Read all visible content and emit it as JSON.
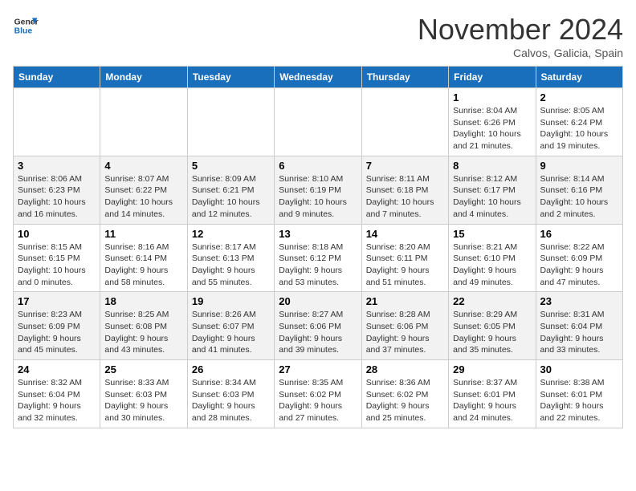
{
  "logo": {
    "line1": "General",
    "line2": "Blue"
  },
  "title": "November 2024",
  "location": "Calvos, Galicia, Spain",
  "weekdays": [
    "Sunday",
    "Monday",
    "Tuesday",
    "Wednesday",
    "Thursday",
    "Friday",
    "Saturday"
  ],
  "weeks": [
    [
      {
        "day": "",
        "info": ""
      },
      {
        "day": "",
        "info": ""
      },
      {
        "day": "",
        "info": ""
      },
      {
        "day": "",
        "info": ""
      },
      {
        "day": "",
        "info": ""
      },
      {
        "day": "1",
        "info": "Sunrise: 8:04 AM\nSunset: 6:26 PM\nDaylight: 10 hours and 21 minutes."
      },
      {
        "day": "2",
        "info": "Sunrise: 8:05 AM\nSunset: 6:24 PM\nDaylight: 10 hours and 19 minutes."
      }
    ],
    [
      {
        "day": "3",
        "info": "Sunrise: 8:06 AM\nSunset: 6:23 PM\nDaylight: 10 hours and 16 minutes."
      },
      {
        "day": "4",
        "info": "Sunrise: 8:07 AM\nSunset: 6:22 PM\nDaylight: 10 hours and 14 minutes."
      },
      {
        "day": "5",
        "info": "Sunrise: 8:09 AM\nSunset: 6:21 PM\nDaylight: 10 hours and 12 minutes."
      },
      {
        "day": "6",
        "info": "Sunrise: 8:10 AM\nSunset: 6:19 PM\nDaylight: 10 hours and 9 minutes."
      },
      {
        "day": "7",
        "info": "Sunrise: 8:11 AM\nSunset: 6:18 PM\nDaylight: 10 hours and 7 minutes."
      },
      {
        "day": "8",
        "info": "Sunrise: 8:12 AM\nSunset: 6:17 PM\nDaylight: 10 hours and 4 minutes."
      },
      {
        "day": "9",
        "info": "Sunrise: 8:14 AM\nSunset: 6:16 PM\nDaylight: 10 hours and 2 minutes."
      }
    ],
    [
      {
        "day": "10",
        "info": "Sunrise: 8:15 AM\nSunset: 6:15 PM\nDaylight: 10 hours and 0 minutes."
      },
      {
        "day": "11",
        "info": "Sunrise: 8:16 AM\nSunset: 6:14 PM\nDaylight: 9 hours and 58 minutes."
      },
      {
        "day": "12",
        "info": "Sunrise: 8:17 AM\nSunset: 6:13 PM\nDaylight: 9 hours and 55 minutes."
      },
      {
        "day": "13",
        "info": "Sunrise: 8:18 AM\nSunset: 6:12 PM\nDaylight: 9 hours and 53 minutes."
      },
      {
        "day": "14",
        "info": "Sunrise: 8:20 AM\nSunset: 6:11 PM\nDaylight: 9 hours and 51 minutes."
      },
      {
        "day": "15",
        "info": "Sunrise: 8:21 AM\nSunset: 6:10 PM\nDaylight: 9 hours and 49 minutes."
      },
      {
        "day": "16",
        "info": "Sunrise: 8:22 AM\nSunset: 6:09 PM\nDaylight: 9 hours and 47 minutes."
      }
    ],
    [
      {
        "day": "17",
        "info": "Sunrise: 8:23 AM\nSunset: 6:09 PM\nDaylight: 9 hours and 45 minutes."
      },
      {
        "day": "18",
        "info": "Sunrise: 8:25 AM\nSunset: 6:08 PM\nDaylight: 9 hours and 43 minutes."
      },
      {
        "day": "19",
        "info": "Sunrise: 8:26 AM\nSunset: 6:07 PM\nDaylight: 9 hours and 41 minutes."
      },
      {
        "day": "20",
        "info": "Sunrise: 8:27 AM\nSunset: 6:06 PM\nDaylight: 9 hours and 39 minutes."
      },
      {
        "day": "21",
        "info": "Sunrise: 8:28 AM\nSunset: 6:06 PM\nDaylight: 9 hours and 37 minutes."
      },
      {
        "day": "22",
        "info": "Sunrise: 8:29 AM\nSunset: 6:05 PM\nDaylight: 9 hours and 35 minutes."
      },
      {
        "day": "23",
        "info": "Sunrise: 8:31 AM\nSunset: 6:04 PM\nDaylight: 9 hours and 33 minutes."
      }
    ],
    [
      {
        "day": "24",
        "info": "Sunrise: 8:32 AM\nSunset: 6:04 PM\nDaylight: 9 hours and 32 minutes."
      },
      {
        "day": "25",
        "info": "Sunrise: 8:33 AM\nSunset: 6:03 PM\nDaylight: 9 hours and 30 minutes."
      },
      {
        "day": "26",
        "info": "Sunrise: 8:34 AM\nSunset: 6:03 PM\nDaylight: 9 hours and 28 minutes."
      },
      {
        "day": "27",
        "info": "Sunrise: 8:35 AM\nSunset: 6:02 PM\nDaylight: 9 hours and 27 minutes."
      },
      {
        "day": "28",
        "info": "Sunrise: 8:36 AM\nSunset: 6:02 PM\nDaylight: 9 hours and 25 minutes."
      },
      {
        "day": "29",
        "info": "Sunrise: 8:37 AM\nSunset: 6:01 PM\nDaylight: 9 hours and 24 minutes."
      },
      {
        "day": "30",
        "info": "Sunrise: 8:38 AM\nSunset: 6:01 PM\nDaylight: 9 hours and 22 minutes."
      }
    ]
  ]
}
